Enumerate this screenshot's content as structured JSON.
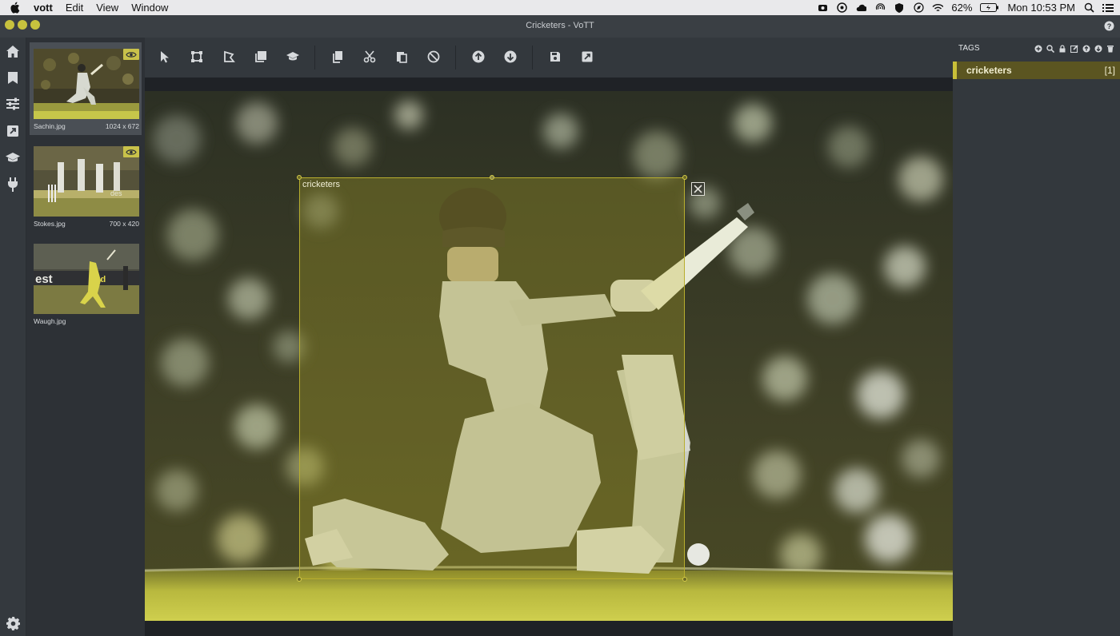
{
  "menubar": {
    "app_name": "vott",
    "items": [
      "Edit",
      "View",
      "Window"
    ],
    "battery": "62%",
    "clock": "Mon 10:53 PM"
  },
  "window": {
    "title": "Cricketers - VoTT"
  },
  "left_nav": {
    "icons": [
      "home-icon",
      "bookmark-icon",
      "sliders-icon",
      "export-icon",
      "graduation-cap-icon",
      "plug-icon",
      "gear-icon"
    ]
  },
  "thumbnails": [
    {
      "filename": "Sachin.jpg",
      "dimensions": "1024 x 672",
      "visited": true
    },
    {
      "filename": "Stokes.jpg",
      "dimensions": "700 x 420",
      "visited": true
    },
    {
      "filename": "Waugh.jpg",
      "dimensions": "",
      "visited": false
    }
  ],
  "toolbar": {
    "tools": [
      "select-icon",
      "rectangle-icon",
      "polygon-icon",
      "copy-rectangle-icon",
      "active-learning-icon",
      "copy-icon",
      "cut-icon",
      "paste-icon",
      "clear-icon",
      "previous-icon",
      "next-icon",
      "save-icon",
      "export-icon"
    ]
  },
  "region": {
    "tag": "cricketers"
  },
  "tags_panel": {
    "header": "TAGS",
    "tags": [
      {
        "name": "cricketers",
        "hotkey": "[1]"
      }
    ],
    "colors": {
      "accent": "#c9bf38",
      "row_bg": "#5b5521"
    }
  }
}
